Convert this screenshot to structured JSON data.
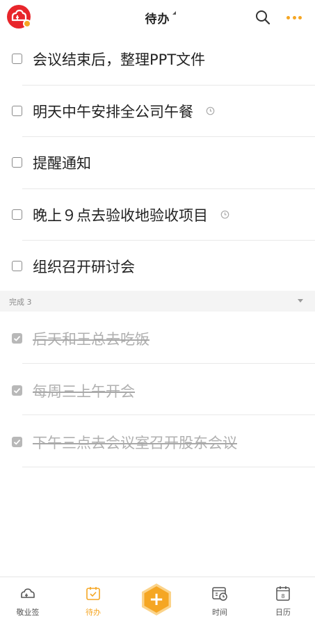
{
  "header": {
    "title": "待办",
    "logo_icon": "cloud-logo-icon",
    "search_icon": "search-icon",
    "more_icon": "more-dots-icon",
    "accent_color": "#f5a623",
    "logo_color": "#e8262b"
  },
  "todos": [
    {
      "text": "会议结束后，整理PPT文件",
      "has_reminder": false
    },
    {
      "text": "明天中午安排全公司午餐",
      "has_reminder": true
    },
    {
      "text": "提醒通知",
      "has_reminder": false
    },
    {
      "text": "晚上９点去验收地验收项目",
      "has_reminder": true
    },
    {
      "text": "组织召开研讨会",
      "has_reminder": false
    }
  ],
  "done_section": {
    "label": "完成 3",
    "items": [
      {
        "text": "后天和王总去吃饭"
      },
      {
        "text": "每周三上午开会"
      },
      {
        "text": "下午三点去会议室召开股东会议"
      }
    ]
  },
  "tabbar": {
    "tabs": [
      {
        "label": "敬业签",
        "icon": "cloud-icon",
        "active": false
      },
      {
        "label": "待办",
        "icon": "calendar-check-icon",
        "active": true
      },
      {
        "label": "时间",
        "icon": "calendar-clock-icon",
        "active": false
      },
      {
        "label": "日历",
        "icon": "calendar-day-icon",
        "active": false
      }
    ],
    "fab_label": "+",
    "calendar_day": "8"
  }
}
